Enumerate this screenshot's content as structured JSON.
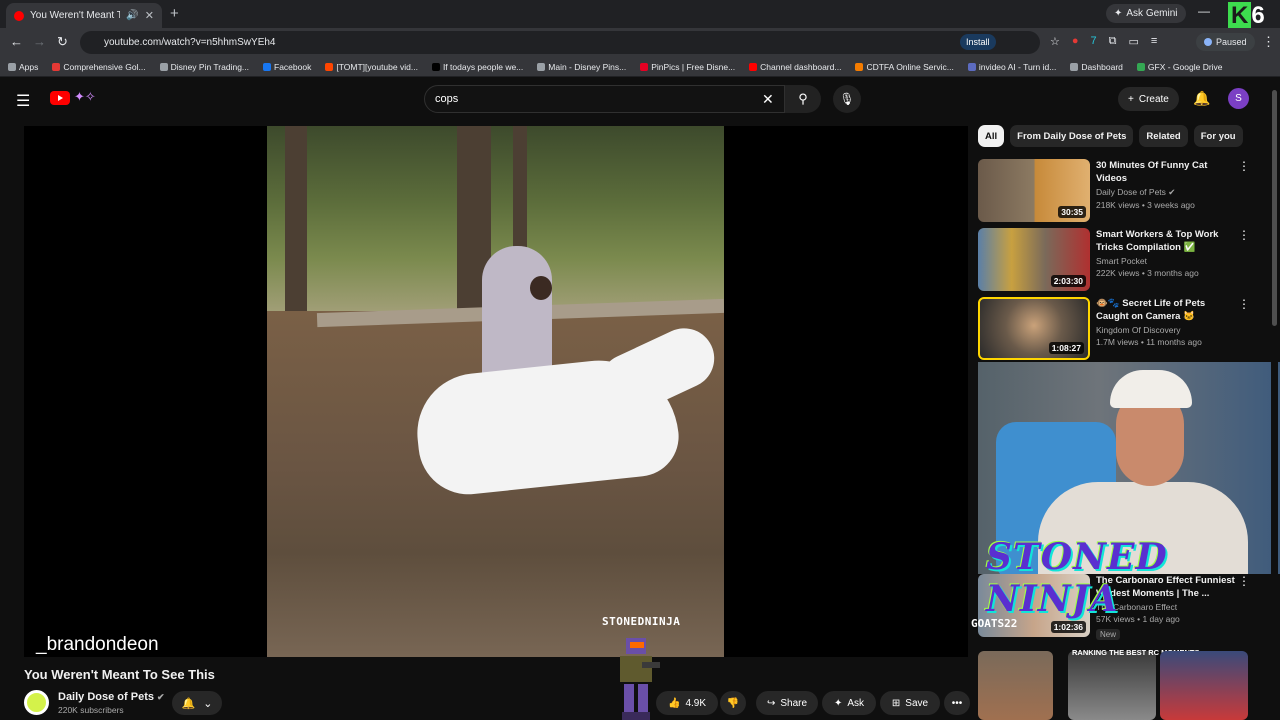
{
  "browser": {
    "tab_title": "You Weren't Meant To See",
    "url": "youtube.com/watch?v=n5hhmSwYEh4",
    "install_label": "Install",
    "ask_gemini_label": "Ask Gemini",
    "paused_label": "Paused",
    "k6_label": "6",
    "bookmarks": [
      "Apps",
      "Comprehensive Gol...",
      "Disney Pin Trading...",
      "Facebook",
      "[TOMT][youtube vid...",
      "If todays people we...",
      "Main - Disney Pins...",
      "PinPics | Free Disne...",
      "Channel dashboard...",
      "CDTFA Online Servic...",
      "invideo AI - Turn id...",
      "Dashboard",
      "GFX - Google Drive"
    ]
  },
  "header": {
    "search_value": "cops",
    "create_label": "Create",
    "avatar_letter": "S"
  },
  "player": {
    "watermark_user": "_brandondeon",
    "watermark_channel": "STONEDNINJA"
  },
  "video": {
    "title": "You Weren't Meant To See This",
    "channel": "Daily Dose of Pets",
    "subscribers": "220K subscribers",
    "likes": "4.9K",
    "share_label": "Share",
    "ask_label": "Ask",
    "save_label": "Save"
  },
  "chips": [
    "All",
    "From Daily Dose of Pets",
    "Related",
    "For you"
  ],
  "recommendations": [
    {
      "title": "30 Minutes Of Funny Cat Videos",
      "channel": "Daily Dose of Pets",
      "meta": "218K views • 3 weeks ago",
      "duration": "30:35"
    },
    {
      "title": "Smart Workers & Top Work Tricks Compilation ✅",
      "channel": "Smart Pocket",
      "meta": "222K views • 3 months ago",
      "duration": "2:03:30"
    },
    {
      "title": "🐵🐾 Secret Life of Pets Caught on Camera 🐱",
      "channel": "Kingdom Of Discovery",
      "meta": "1.7M views • 11 months ago",
      "duration": "1:08:27"
    },
    {
      "title": "The Carbonaro Effect Funniest Wildest Moments | The ...",
      "channel": "The Carbonaro Effect",
      "meta": "57K views • 1 day ago",
      "duration": "1:02:36",
      "badge": "New"
    }
  ],
  "overlay": {
    "stoned_ninja": "STONED NINJA",
    "goats_label": "GOATS22",
    "ranking_label": "RANKING THE BEST RC MOMENTS"
  },
  "colors": {
    "background": "#0f0f0f",
    "accent": "#ff0000",
    "highlight_border": "#ffd600"
  }
}
